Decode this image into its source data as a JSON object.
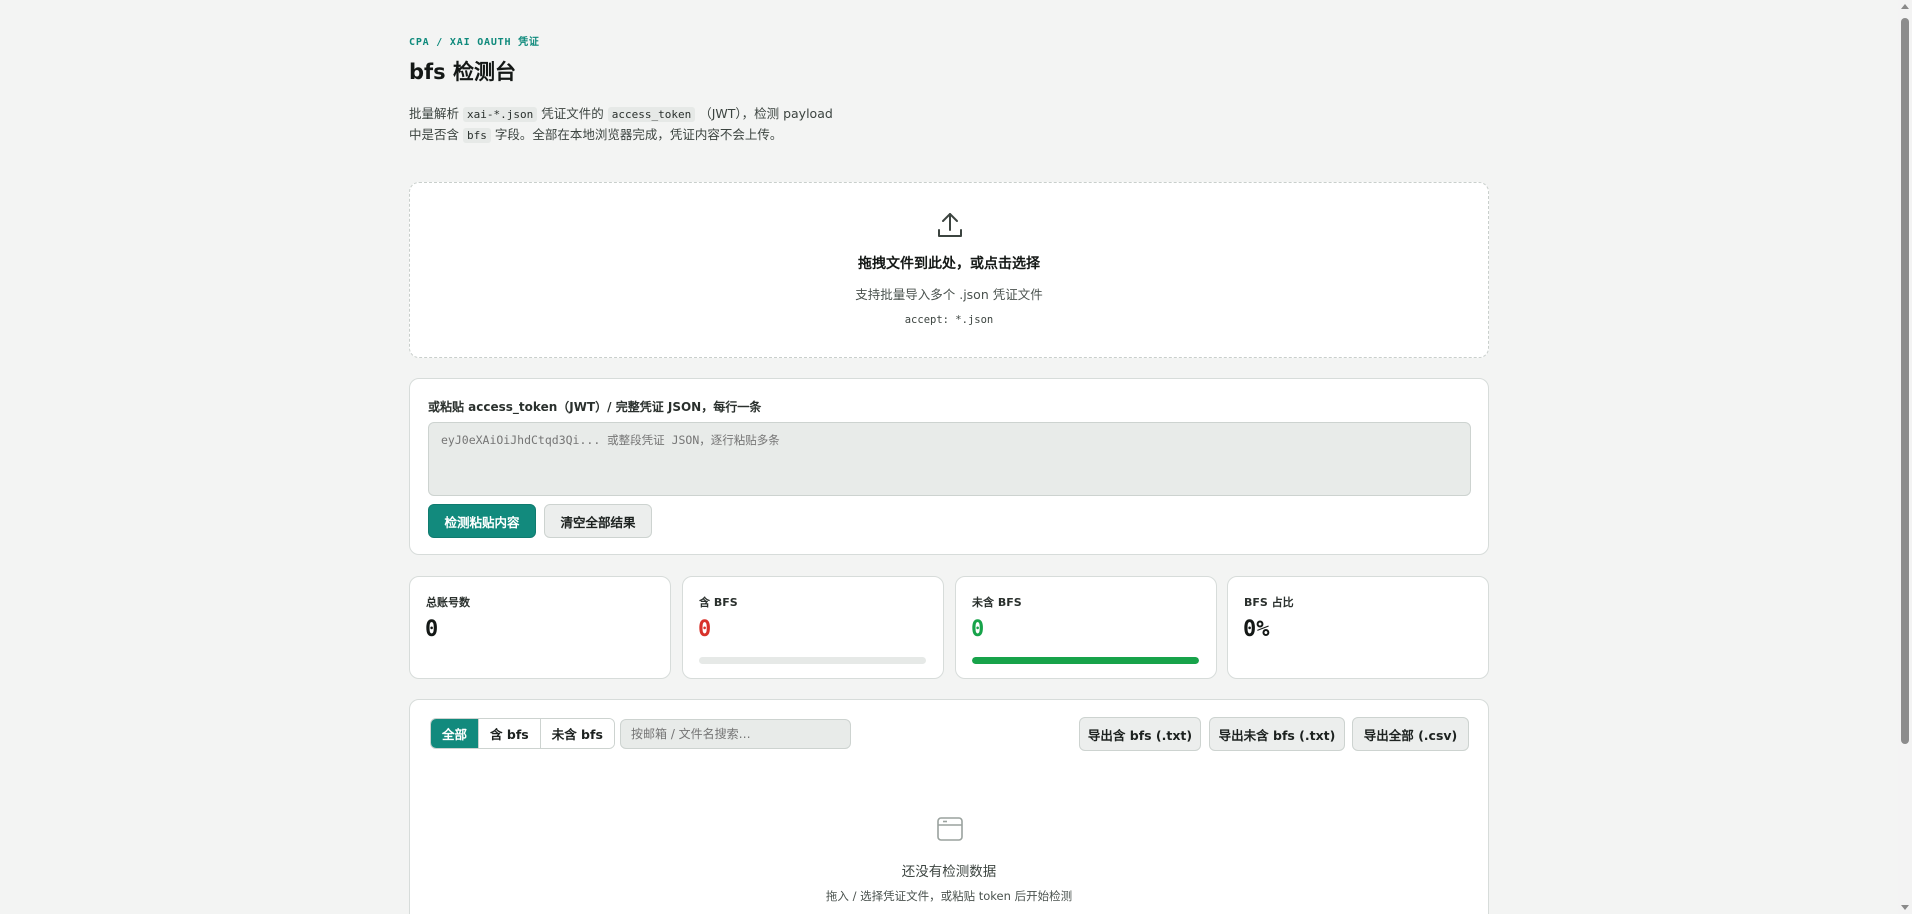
{
  "header": {
    "eyebrow": "CPA / XAI OAUTH 凭证",
    "title": "bfs 检测台",
    "desc": {
      "p1": "批量解析",
      "code1": "xai-*.json",
      "p2": "凭证文件的",
      "code2": "access_token",
      "p3": "（JWT），检测 payload 中是否含",
      "code3": "bfs",
      "p4": "字段。全部在本地浏览器完成，凭证内容不会上传。"
    }
  },
  "dropzone": {
    "icon": "upload-icon",
    "title": "拖拽文件到此处，或点击选择",
    "subtitle": "支持批量导入多个 .json 凭证文件",
    "accept": "accept: *.json"
  },
  "paste": {
    "label": "或粘贴 access_token（JWT）/ 完整凭证 JSON，每行一条",
    "placeholder": "eyJ0eXAiOiJhdCtqd3Qi... 或整段凭证 JSON，逐行粘贴多条",
    "value": "",
    "detect_label": "检测粘贴内容",
    "clear_label": "清空全部结果"
  },
  "stats": [
    {
      "label": "总账号数",
      "value": "0",
      "color": "#141816"
    },
    {
      "label": "含 BFS",
      "value": "0",
      "color": "#d8322b",
      "bar_fraction": 0,
      "bar_color": "#d8322b"
    },
    {
      "label": "未含 BFS",
      "value": "0",
      "color": "#17a34a",
      "bar_fraction": 1,
      "bar_color": "#17a34a"
    },
    {
      "label": "BFS 占比",
      "value": "0%",
      "color": "#141816"
    }
  ],
  "results": {
    "filters": [
      "全部",
      "含 bfs",
      "未含 bfs"
    ],
    "active_filter": 0,
    "search_placeholder": "按邮箱 / 文件名搜索…",
    "search_value": "",
    "export_has": "导出含 bfs (.txt)",
    "export_without": "导出未含 bfs (.txt)",
    "export_all": "导出全部 (.csv)",
    "empty_icon": "empty-box-icon",
    "empty_title": "还没有检测数据",
    "empty_subtitle": "拖入 / 选择凭证文件，或粘贴 token 后开始检测"
  },
  "colors": {
    "accent": "#128a7d",
    "danger": "#d8322b",
    "success": "#17a34a"
  }
}
